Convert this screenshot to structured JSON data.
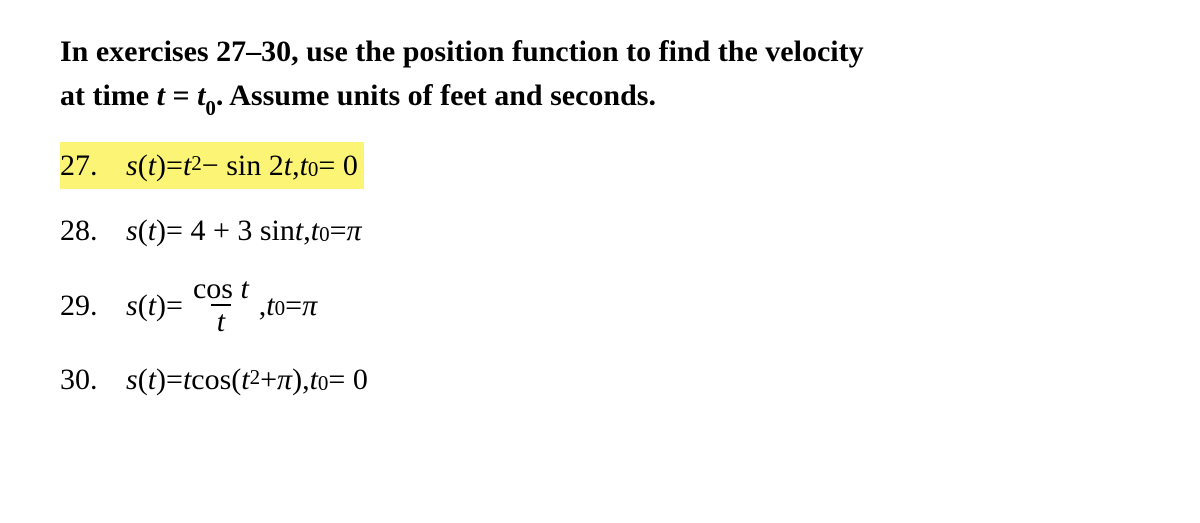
{
  "instructions": {
    "line1_pre": "In exercises 27–30, use the position function to find the velocity",
    "line2_pre": "at time ",
    "line2_var": "t",
    "line2_eq": " = ",
    "line2_t": "t",
    "line2_sub": "0",
    "line2_post": ". Assume units of feet and seconds."
  },
  "ex27": {
    "num": "27.",
    "s": "s",
    "open": "(",
    "t": "t",
    "close": ")",
    "eq": " = ",
    "tvar": "t",
    "sq": "2",
    "minus": " − sin 2",
    "t2": "t",
    "comma": " , ",
    "t0t": "t",
    "t0s": "0",
    "eq2": " = 0"
  },
  "ex28": {
    "num": "28.",
    "s": "s",
    "open": "(",
    "t": "t",
    "close": ")",
    "eq": " = 4 + 3 sin ",
    "tvar": "t",
    "comma": " , ",
    "t0t": "t",
    "t0s": "0",
    "eq2": " = ",
    "pi": "π"
  },
  "ex29": {
    "num": "29.",
    "s": "s",
    "open": "(",
    "t": "t",
    "close": ")",
    "eq": " = ",
    "numtxt": "cos ",
    "numvar": "t",
    "denvar": "t",
    "comma": " , ",
    "t0t": "t",
    "t0s": "0",
    "eq2": " = ",
    "pi": "π"
  },
  "ex30": {
    "num": "30.",
    "s": "s",
    "open": "(",
    "t": "t",
    "close": ")",
    "eq": " = ",
    "tvar": "t",
    "cos": " cos(",
    "t2": "t",
    "sq": "2",
    "pluspi": " + ",
    "pi": "π",
    "cls": "), ",
    "t0t": "t",
    "t0s": "0",
    "eq2": " = 0"
  }
}
